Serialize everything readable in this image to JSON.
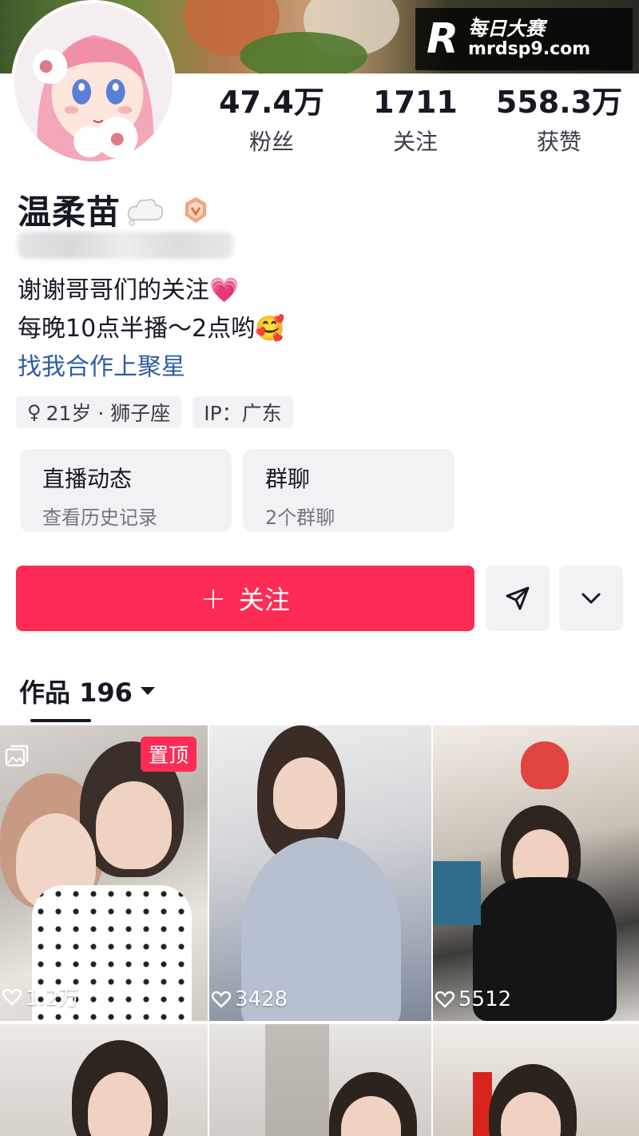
{
  "watermark": {
    "logo": "R",
    "line1": "每日大赛",
    "line2": "mrdsp9.com"
  },
  "stats": [
    {
      "value": "47.4万",
      "label": "粉丝"
    },
    {
      "value": "1711",
      "label": "关注"
    },
    {
      "value": "558.3万",
      "label": "获赞"
    }
  ],
  "profile": {
    "name": "温柔苗",
    "bio_line1": "谢谢哥哥们的关注💗",
    "bio_line2": "每晚10点半播～2点哟🥰",
    "bio_link": "找我合作上聚星"
  },
  "tags": [
    {
      "icon": "female-symbol",
      "symbol": "♀",
      "text": "21岁 · 狮子座"
    },
    {
      "text": "IP：广东"
    }
  ],
  "cards": [
    {
      "title": "直播动态",
      "subtitle": "查看历史记录"
    },
    {
      "title": "群聊",
      "subtitle": "2个群聊"
    }
  ],
  "actions": {
    "follow_plus": "+",
    "follow_label": "关注"
  },
  "works": {
    "tab_label": "作品 196"
  },
  "videos": [
    {
      "pin": "置顶",
      "likes": "1.2万"
    },
    {
      "likes": "3428"
    },
    {
      "likes": "5512"
    },
    {},
    {},
    {}
  ],
  "colors": {
    "accent": "#fe2c55",
    "link": "#2f5da3",
    "card_bg": "#f2f2f4"
  }
}
